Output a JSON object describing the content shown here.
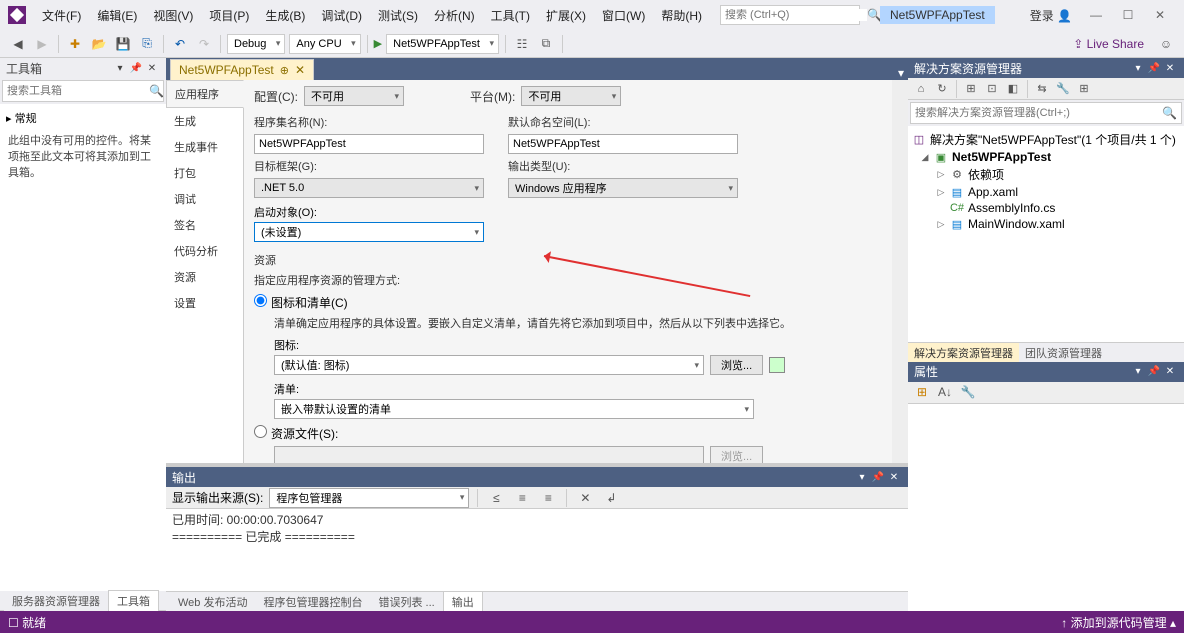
{
  "titlebar": {
    "menus": [
      "文件(F)",
      "编辑(E)",
      "视图(V)",
      "项目(P)",
      "生成(B)",
      "调试(D)",
      "测试(S)",
      "分析(N)",
      "工具(T)",
      "扩展(X)",
      "窗口(W)",
      "帮助(H)"
    ],
    "search_placeholder": "搜索 (Ctrl+Q)",
    "project_name": "Net5WPFAppTest",
    "login": "登录",
    "liveshare": "Live Share"
  },
  "toolbar": {
    "config": "Debug",
    "platform": "Any CPU",
    "start": "Net5WPFAppTest"
  },
  "toolbox": {
    "title": "工具箱",
    "search_placeholder": "搜索工具箱",
    "category": "▸ 常规",
    "empty": "此组中没有可用的控件。将某项拖至此文本可将其添加到工具箱。",
    "tabs": [
      "服务器资源管理器",
      "工具箱"
    ]
  },
  "editor": {
    "tab": "Net5WPFAppTest",
    "side_tabs": [
      "应用程序",
      "生成",
      "生成事件",
      "打包",
      "调试",
      "签名",
      "代码分析",
      "资源",
      "设置"
    ],
    "config_label": "配置(C):",
    "config_val": "不可用",
    "platform_label": "平台(M):",
    "platform_val": "不可用",
    "assembly_name_label": "程序集名称(N):",
    "assembly_name": "Net5WPFAppTest",
    "default_ns_label": "默认命名空间(L):",
    "default_ns": "Net5WPFAppTest",
    "target_fw_label": "目标框架(G):",
    "target_fw": ".NET 5.0",
    "output_type_label": "输出类型(U):",
    "output_type": "Windows 应用程序",
    "startup_label": "启动对象(O):",
    "startup": "(未设置)",
    "res_header": "资源",
    "res_desc": "指定应用程序资源的管理方式:",
    "radio_icon": "图标和清单(C)",
    "icon_desc": "清单确定应用程序的具体设置。要嵌入自定义清单，请首先将它添加到项目中，然后从以下列表中选择它。",
    "icon_label": "图标:",
    "icon_val": "(默认值: 图标)",
    "browse": "浏览...",
    "manifest_label": "清单:",
    "manifest_val": "嵌入带默认设置的清单",
    "radio_resfile": "资源文件(S):"
  },
  "output": {
    "title": "输出",
    "src_label": "显示输出来源(S):",
    "src_val": "程序包管理器",
    "line1": "已用时间: 00:00:00.7030647",
    "line2": "========== 已完成 ==========",
    "tabs": [
      "Web 发布活动",
      "程序包管理器控制台",
      "错误列表 ...",
      "输出"
    ]
  },
  "solution": {
    "title": "解决方案资源管理器",
    "search_placeholder": "搜索解决方案资源管理器(Ctrl+;)",
    "root": "解决方案\"Net5WPFAppTest\"(1 个项目/共 1 个)",
    "proj": "Net5WPFAppTest",
    "deps": "依赖项",
    "appxaml": "App.xaml",
    "asm": "AssemblyInfo.cs",
    "mainwin": "MainWindow.xaml",
    "tabs": [
      "解决方案资源管理器",
      "团队资源管理器"
    ]
  },
  "properties": {
    "title": "属性"
  },
  "status": {
    "ready": "就绪",
    "src_ctrl": "添加到源代码管理"
  }
}
